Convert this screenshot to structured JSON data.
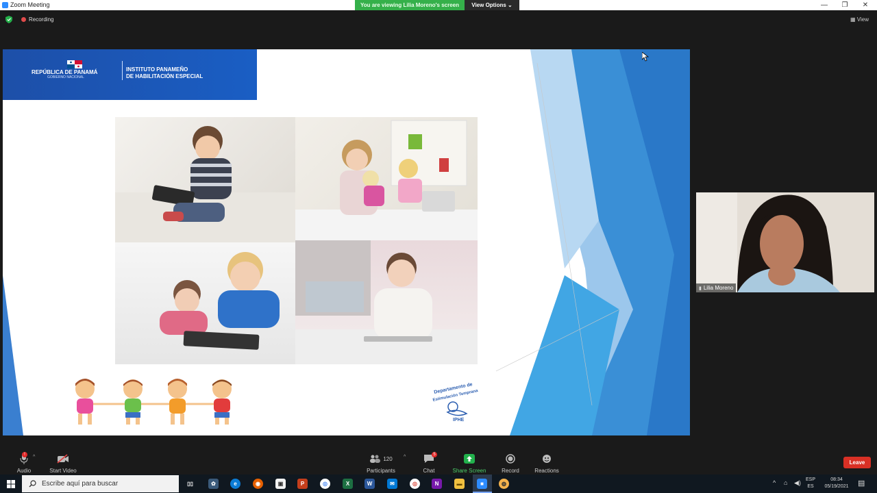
{
  "window": {
    "title": "Zoom Meeting",
    "minimize": "—",
    "restore": "❐",
    "close": "✕"
  },
  "viewing_banner": "You are viewing Lilia Moreno's screen",
  "view_options": "View Options ⌄",
  "recording_label": "Recording",
  "view_button": "View",
  "slide": {
    "banner_line1": "REPÚBLICA DE PANAMÁ",
    "banner_line2": "GOBIERNO NACIONAL",
    "banner_org_line1": "INSTITUTO PANAMEÑO",
    "banner_org_line2": "DE HABILITACIÓN ESPECIAL",
    "logo_line1": "Departamento de",
    "logo_line2": "Estimulación Temprana",
    "logo_line3": "IPHE"
  },
  "participant": {
    "name": "Lilia Moreno"
  },
  "toolbar": {
    "audio": "Audio",
    "audio_badge": "!",
    "start_video": "Start Video",
    "participants": "Participants",
    "participants_count": "120",
    "chat": "Chat",
    "chat_badge": "5",
    "share_screen": "Share Screen",
    "record": "Record",
    "reactions": "Reactions",
    "leave": "Leave"
  },
  "taskbar": {
    "search_placeholder": "Escribe aquí para buscar",
    "lang_top": "ESP",
    "lang_bottom": "ES",
    "time": "08:34",
    "date": "05/19/2021"
  },
  "colors": {
    "zoom_blue": "#2d8cff",
    "green_banner": "#35b04a",
    "share_green": "#22b14c",
    "leave_red": "#d93025",
    "slide_blue": "#1d4fa8"
  }
}
